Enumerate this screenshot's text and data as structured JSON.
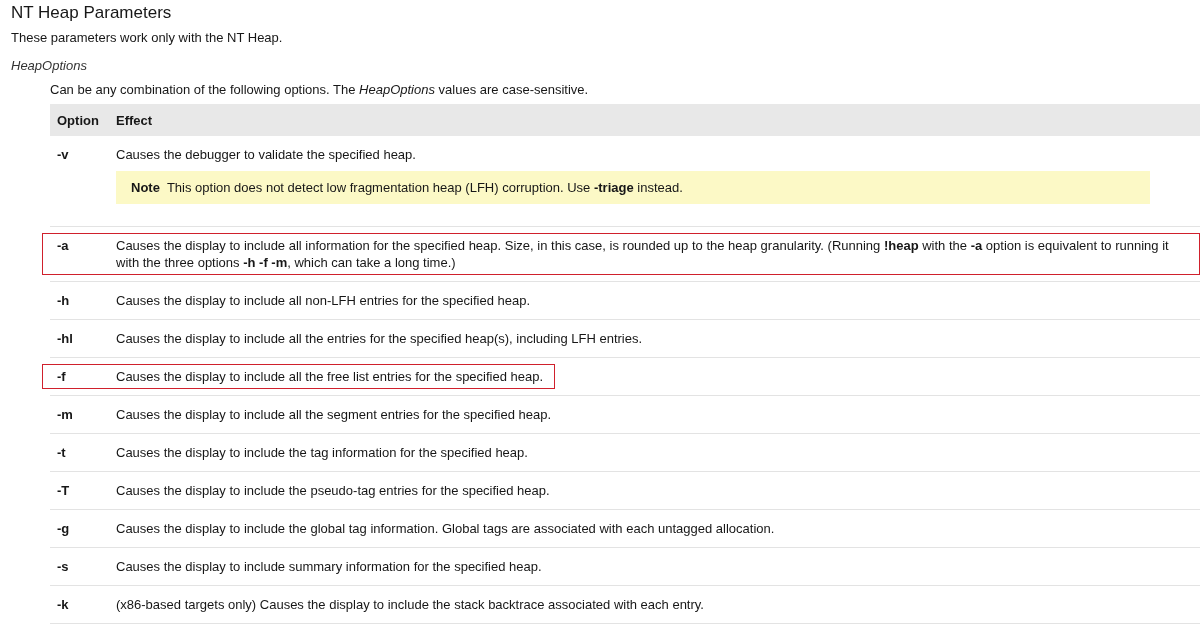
{
  "title": "NT Heap Parameters",
  "intro": "These parameters work only with the NT Heap.",
  "parameter": {
    "name": "HeapOptions",
    "description": "Can be any combination of the following options. The *HeapOptions* values are case-sensitive."
  },
  "table": {
    "columns": [
      "Option",
      "Effect"
    ],
    "rows": [
      {
        "option": "-v",
        "effect": "Causes the debugger to validate the specified heap.",
        "highlighted": false,
        "note": {
          "label": "Note",
          "text": "This option does not detect low fragmentation heap (LFH) corruption. Use **-triage** instead."
        }
      },
      {
        "option": "-a",
        "effect": "Causes the display to include all information for the specified heap. Size, in this case, is rounded up to the heap granularity. (Running **!heap** with the **-a** option is equivalent to running it with the three options **-h -f -m**, which can take a long time.)",
        "highlighted": true
      },
      {
        "option": "-h",
        "effect": "Causes the display to include all non-LFH entries for the specified heap.",
        "highlighted": false
      },
      {
        "option": "-hl",
        "effect": "Causes the display to include all the entries for the specified heap(s), including LFH entries.",
        "highlighted": false
      },
      {
        "option": "-f",
        "effect": "Causes the display to include all the free list entries for the specified heap.",
        "highlighted": true
      },
      {
        "option": "-m",
        "effect": "Causes the display to include all the segment entries for the specified heap.",
        "highlighted": false
      },
      {
        "option": "-t",
        "effect": "Causes the display to include the tag information for the specified heap.",
        "highlighted": false
      },
      {
        "option": "-T",
        "effect": "Causes the display to include the pseudo-tag entries for the specified heap.",
        "highlighted": false
      },
      {
        "option": "-g",
        "effect": "Causes the display to include the global tag information. Global tags are associated with each untagged allocation.",
        "highlighted": false
      },
      {
        "option": "-s",
        "effect": "Causes the display to include summary information for the specified heap.",
        "highlighted": false
      },
      {
        "option": "-k",
        "effect": "(x86-based targets only) Causes the display to include the stack backtrace associated with each entry.",
        "highlighted": false
      }
    ]
  }
}
